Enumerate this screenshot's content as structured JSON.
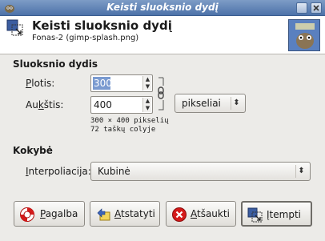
{
  "window": {
    "title": "Keisti sluoksnio dydį"
  },
  "header": {
    "title": "Keisti sluoksnio dydį",
    "subtitle": "Fonas-2 (gimp-splash.png)"
  },
  "size_section": {
    "heading": "Sluoksnio dydis",
    "width_label_u": "P",
    "width_label_rest": "lotis:",
    "width_value": "300",
    "height_label_pre": "Au",
    "height_label_u": "k",
    "height_label_rest": "štis:",
    "height_value": "400",
    "unit": "pikseliai",
    "info_line1": "300 × 400 pikselių",
    "info_line2": "72 taškų colyje"
  },
  "quality_section": {
    "heading": "Kokybė",
    "interp_label_u": "I",
    "interp_label_rest": "nterpoliacija:",
    "interp_value": "Kubinė"
  },
  "buttons": {
    "help_u": "P",
    "help_rest": "agalba",
    "reset_u": "A",
    "reset_rest": "tstatyti",
    "cancel_u": "A",
    "cancel_rest": "tšaukti",
    "scale_u": "Į",
    "scale_rest": "tempti"
  },
  "colors": {
    "titlebar": "#5b7fb4",
    "selection": "#7a9ad0"
  }
}
